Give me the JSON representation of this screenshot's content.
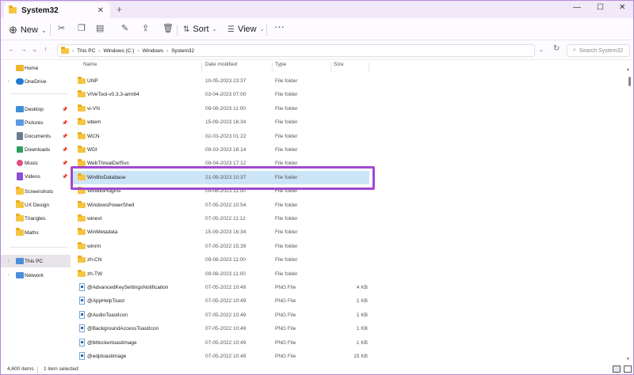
{
  "window": {
    "tab_title": "System32",
    "new_tab": "+",
    "controls": {
      "minimize": "—",
      "maximize": "☐",
      "close": "✕"
    }
  },
  "toolbar": {
    "new_label": "New",
    "sort_label": "Sort",
    "view_label": "View",
    "more_label": "···"
  },
  "address": {
    "crumbs": [
      "This PC",
      "Windows (C:)",
      "Windows",
      "System32"
    ],
    "search_placeholder": "Search System32"
  },
  "sidebar": {
    "items": [
      {
        "label": "Home"
      },
      {
        "label": "OneDrive"
      },
      {
        "label": "Desktop",
        "icon_color": "#3f8fd6"
      },
      {
        "label": "Pictures",
        "icon_color": "#5a9be0"
      },
      {
        "label": "Documents",
        "icon_color": "#6b7c93"
      },
      {
        "label": "Downloads",
        "icon_color": "#2e9e5b"
      },
      {
        "label": "Music",
        "icon_color": "#e0517a"
      },
      {
        "label": "Videos",
        "icon_color": "#8a4fd4"
      },
      {
        "label": "Screenshots"
      },
      {
        "label": "UX Design"
      },
      {
        "label": "Triangles"
      },
      {
        "label": "Maths"
      },
      {
        "label": "This PC"
      },
      {
        "label": "Network"
      }
    ]
  },
  "columns": {
    "name": "Name",
    "date": "Date modified",
    "type": "Type",
    "size": "Size"
  },
  "files": [
    {
      "name": "UNP",
      "date": "10-05-2023 23:37",
      "type": "File folder",
      "size": ""
    },
    {
      "name": "ViVeTool-v0.3.3-arm64",
      "date": "03-04-2023 07:00",
      "type": "File folder",
      "size": ""
    },
    {
      "name": "vi-VN",
      "date": "09-08-2023 11:00",
      "type": "File folder",
      "size": ""
    },
    {
      "name": "wbem",
      "date": "15-09-2023 16:34",
      "type": "File folder",
      "size": ""
    },
    {
      "name": "WCN",
      "date": "02-03-2023 01:22",
      "type": "File folder",
      "size": ""
    },
    {
      "name": "WDI",
      "date": "09-03-2023 18:14",
      "type": "File folder",
      "size": ""
    },
    {
      "name": "WebThreatDefSvc",
      "date": "09-04-2023 17:12",
      "type": "File folder",
      "size": ""
    },
    {
      "name": "WinBioDatabase",
      "date": "21-09-2023 10:37",
      "type": "File folder",
      "size": ""
    },
    {
      "name": "WinBioPlugIns",
      "date": "09-08-2023 11:00",
      "type": "File folder",
      "size": ""
    },
    {
      "name": "WindowsPowerShell",
      "date": "07-05-2022 10:54",
      "type": "File folder",
      "size": ""
    },
    {
      "name": "winevt",
      "date": "07-05-2022 11:12",
      "type": "File folder",
      "size": ""
    },
    {
      "name": "WinMetadata",
      "date": "15-09-2023 16:34",
      "type": "File folder",
      "size": ""
    },
    {
      "name": "winrm",
      "date": "07-05-2022 15:39",
      "type": "File folder",
      "size": ""
    },
    {
      "name": "zh-CN",
      "date": "09-08-2023 11:00",
      "type": "File folder",
      "size": ""
    },
    {
      "name": "zh-TW",
      "date": "09-08-2023 11:00",
      "type": "File folder",
      "size": ""
    },
    {
      "name": "@AdvancedKeySettingsNotification",
      "date": "07-05-2022 10:49",
      "type": "PNG File",
      "size": "4 KB"
    },
    {
      "name": "@AppHelpToast",
      "date": "07-05-2022 10:49",
      "type": "PNG File",
      "size": "1 KB"
    },
    {
      "name": "@AudioToastIcon",
      "date": "07-05-2022 10:49",
      "type": "PNG File",
      "size": "1 KB"
    },
    {
      "name": "@BackgroundAccessToastIcon",
      "date": "07-05-2022 10:49",
      "type": "PNG File",
      "size": "1 KB"
    },
    {
      "name": "@bitlockertoastimage",
      "date": "07-05-2022 10:49",
      "type": "PNG File",
      "size": "1 KB"
    },
    {
      "name": "@edptoastimage",
      "date": "07-05-2022 10:49",
      "type": "PNG File",
      "size": "15 KB"
    }
  ],
  "status": {
    "count": "4,600 items",
    "selected": "1 item selected"
  },
  "colors": {
    "accent_highlight": "#a347d1",
    "selection": "#cce4f7",
    "folder": "#f5c542"
  }
}
